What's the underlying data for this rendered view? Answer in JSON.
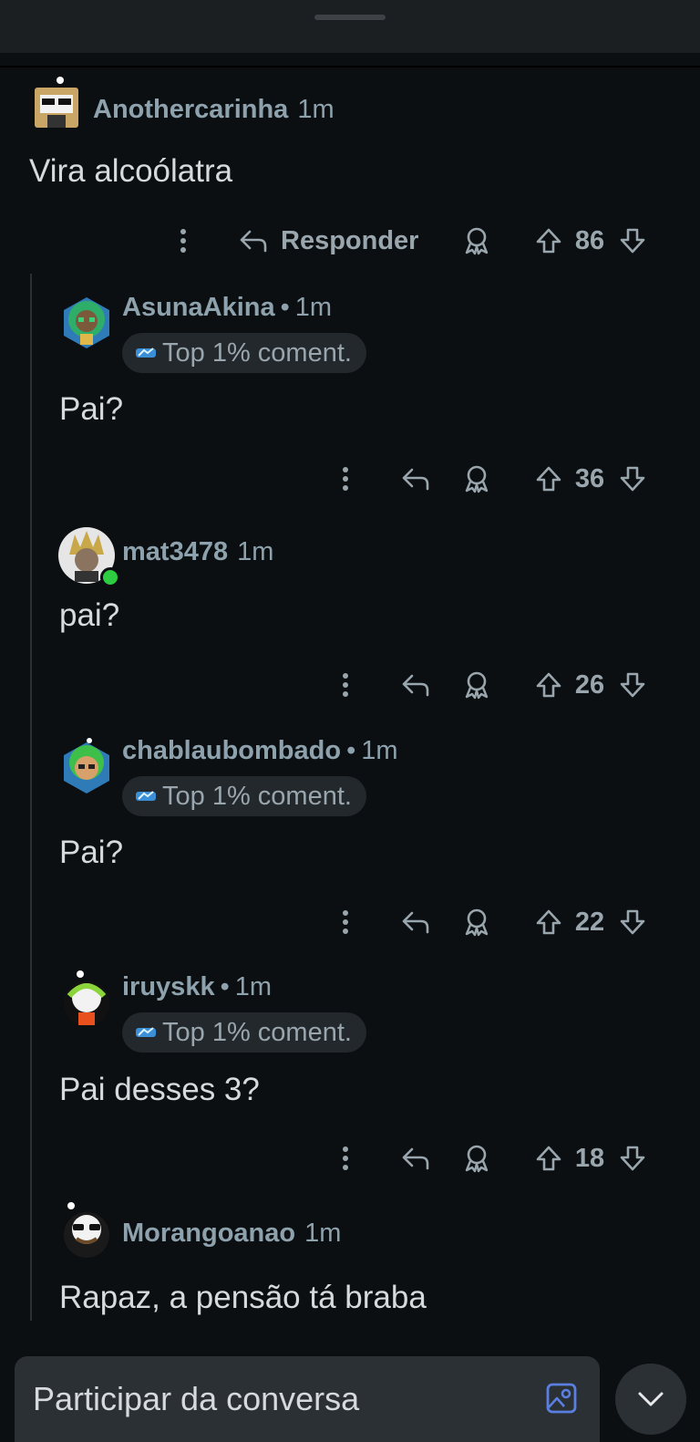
{
  "composer": {
    "placeholder": "Participar da conversa"
  },
  "badge_label": "Top 1% coment.",
  "colors": {
    "background": "#0b0f12",
    "text": "#d7dadc",
    "muted": "#8ea2ad",
    "online": "#2ecc40"
  },
  "comments": [
    {
      "username": "Anothercarinha",
      "time": "1m",
      "text": "Vira alcoólatra",
      "score": "86",
      "reply_label": "Responder",
      "has_badge": false
    },
    {
      "username": "AsunaAkina",
      "time": "1m",
      "text": "Pai?",
      "score": "36",
      "has_badge": true
    },
    {
      "username": "mat3478",
      "time": "1m",
      "text": "pai?",
      "score": "26",
      "has_badge": false,
      "online": true
    },
    {
      "username": "chablaubombado",
      "time": "1m",
      "text": "Pai?",
      "score": "22",
      "has_badge": true
    },
    {
      "username": "iruyskk",
      "time": "1m",
      "text": "Pai desses 3?",
      "score": "18",
      "has_badge": true
    },
    {
      "username": "Morangoanao",
      "time": "1m",
      "text": "Rapaz, a pensão tá braba",
      "has_badge": false
    }
  ]
}
